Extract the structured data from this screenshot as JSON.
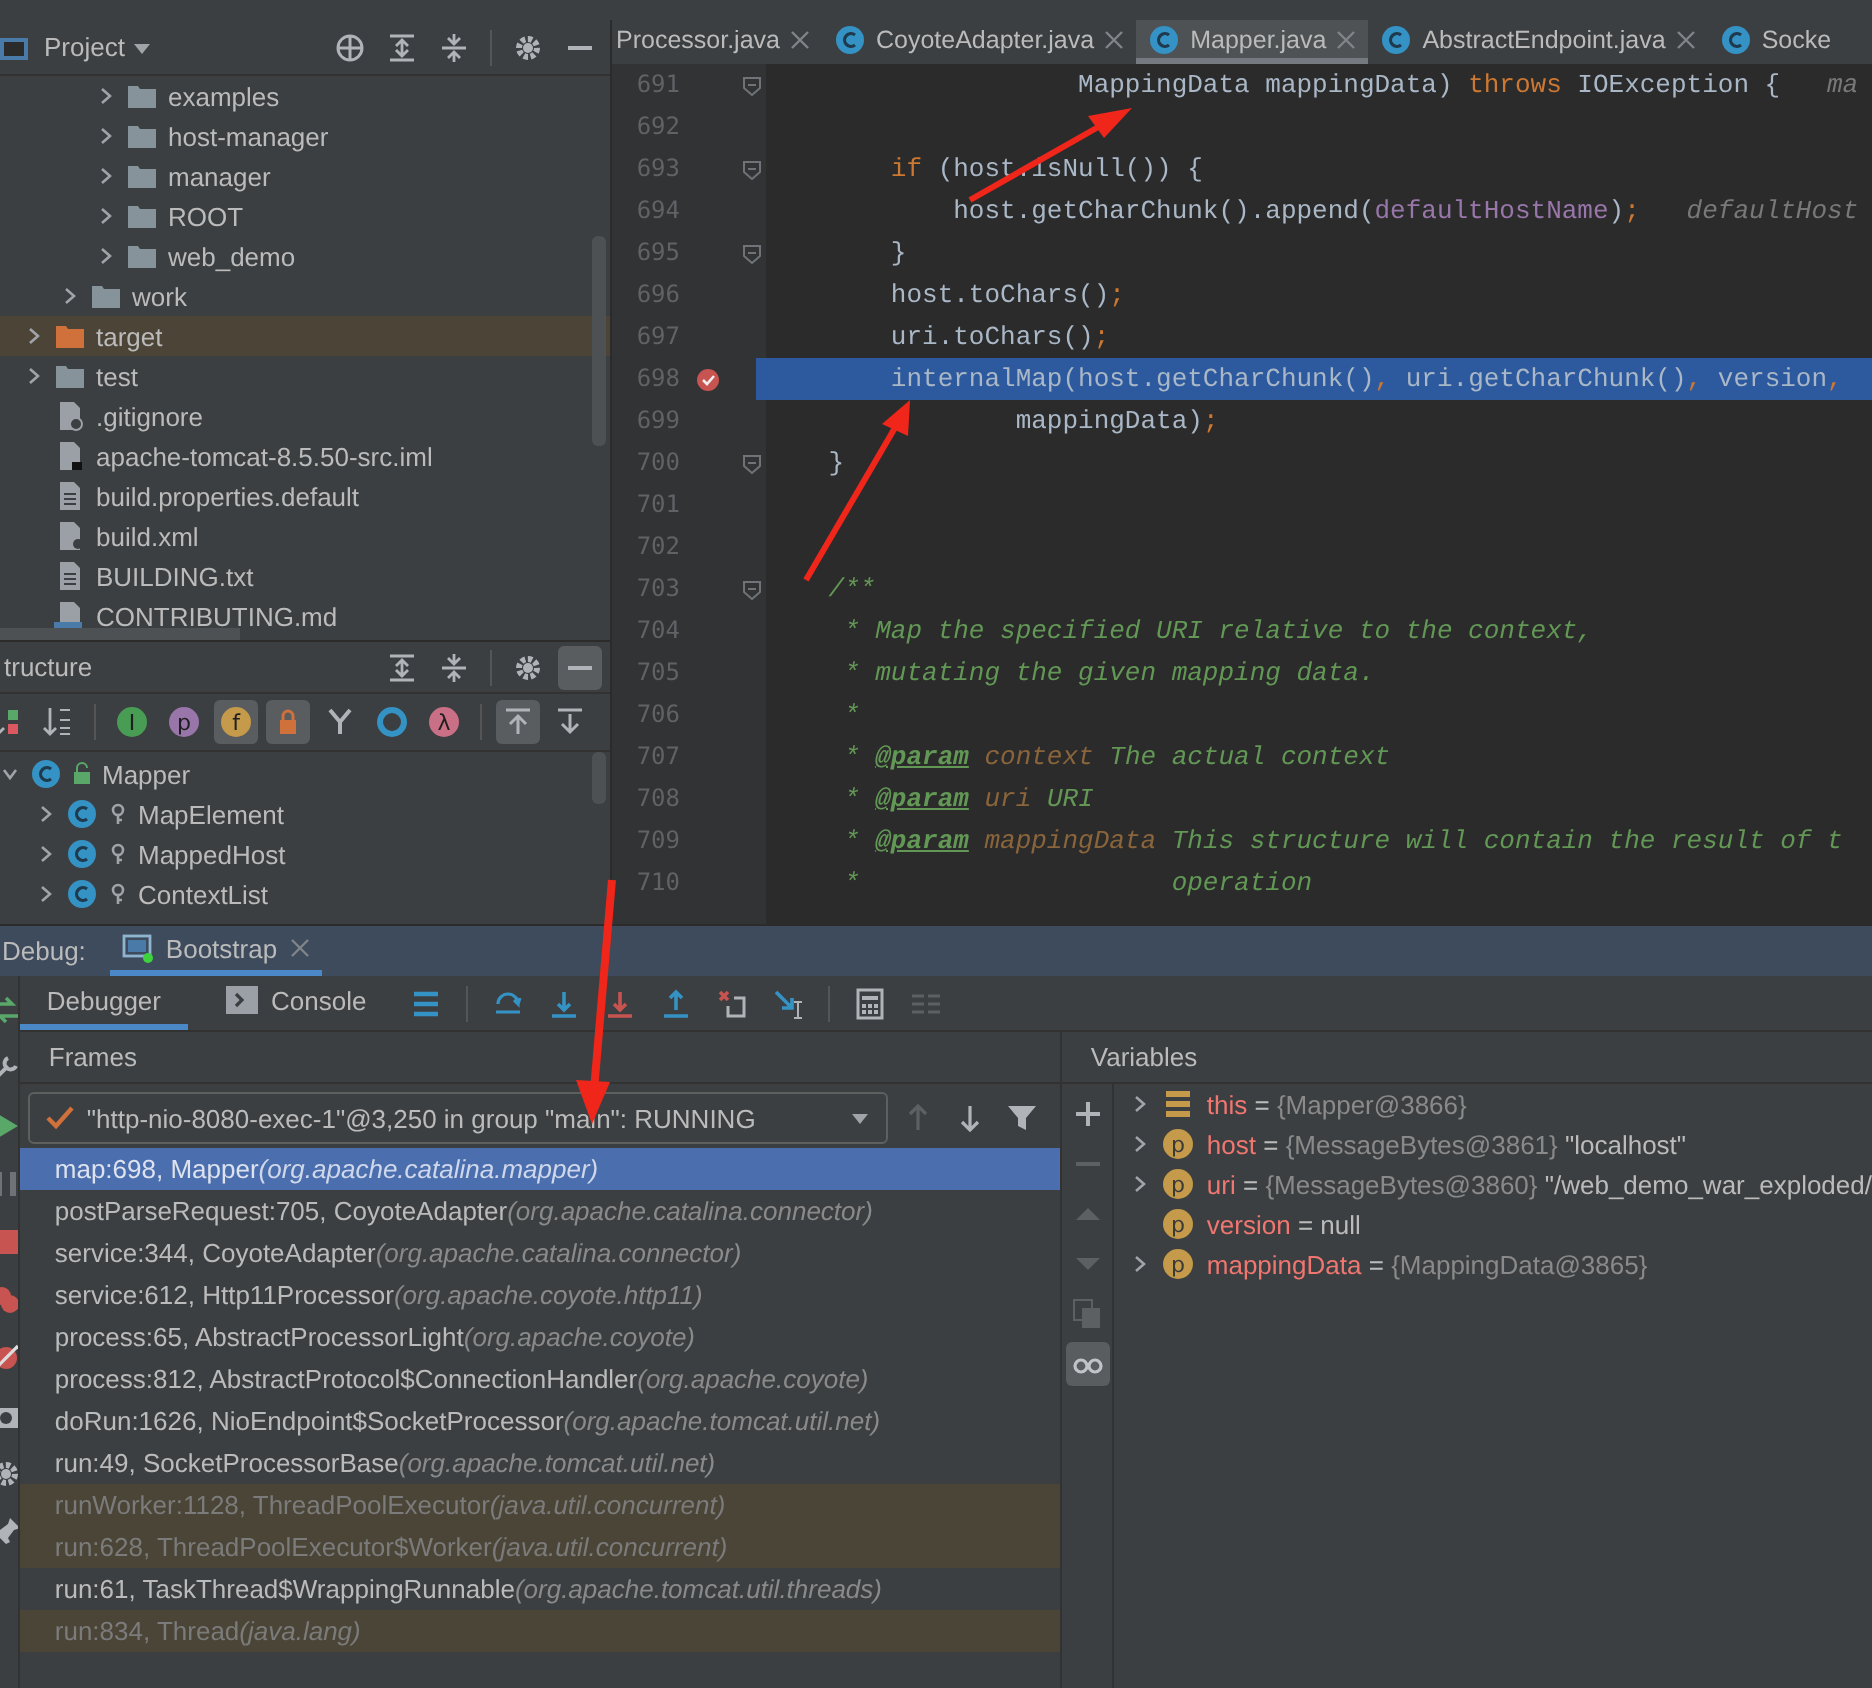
{
  "project": {
    "title": "Project",
    "tree": [
      {
        "children": [
          {
            "children": [
              {
                "label": "examples",
                "kind": "folder",
                "selected": false
              },
              {
                "label": "host-manager",
                "kind": "folder",
                "selected": false
              },
              {
                "label": "manager",
                "kind": "folder",
                "selected": false
              },
              {
                "label": "ROOT",
                "kind": "folder",
                "selected": false
              },
              {
                "label": "web_demo",
                "kind": "folder",
                "selected": false
              }
            ]
          },
          {
            "label": "work",
            "kind": "folder",
            "selected": false
          }
        ]
      },
      {
        "label": "target",
        "kind": "excluded-folder",
        "selected": true
      },
      {
        "label": "test",
        "kind": "folder",
        "selected": false
      },
      {
        "label": ".gitignore",
        "kind": "ignore-file",
        "selected": false
      },
      {
        "label": "apache-tomcat-8.5.50-src.iml",
        "kind": "module-file",
        "selected": false
      },
      {
        "label": "build.properties.default",
        "kind": "text-file",
        "selected": false
      },
      {
        "label": "build.xml",
        "kind": "ant-file",
        "selected": false
      },
      {
        "label": "BUILDING.txt",
        "kind": "text-file",
        "selected": false
      },
      {
        "label": "CONTRIBUTING.md",
        "kind": "markdown-file",
        "selected": false
      }
    ]
  },
  "structure": {
    "title": "tructure",
    "tools": [
      {
        "kind": "visibility-sort",
        "on": false
      },
      {
        "kind": "alpha-sort",
        "on": false
      },
      {
        "kind": "badge",
        "glyph": "I",
        "color": "#499c54",
        "on": false
      },
      {
        "kind": "badge",
        "glyph": "p",
        "color": "#9876aa",
        "on": false
      },
      {
        "kind": "badge",
        "glyph": "f",
        "color": "#c59a4a",
        "on": true
      },
      {
        "kind": "lock",
        "on": true
      },
      {
        "kind": "fork",
        "on": false
      },
      {
        "kind": "ring",
        "on": false
      },
      {
        "kind": "badge",
        "glyph": "λ",
        "color": "#c96f86",
        "on": false
      },
      {
        "kind": "autoscroll-to",
        "on": true
      },
      {
        "kind": "autoscroll-from",
        "on": false
      }
    ],
    "items": [
      {
        "label": "Mapper",
        "expanded": true,
        "children": [
          {
            "label": "MapElement",
            "expanded": false
          },
          {
            "label": "MappedHost",
            "expanded": false
          },
          {
            "label": "ContextList",
            "expanded": false
          }
        ]
      }
    ]
  },
  "editor": {
    "tabs": [
      {
        "label": "Processor.java",
        "selected": false
      },
      {
        "label": "CoyoteAdapter.java",
        "selected": false
      },
      {
        "label": "Mapper.java",
        "selected": true
      },
      {
        "label": "AbstractEndpoint.java",
        "selected": false
      },
      {
        "label": "Socke",
        "selected": false
      }
    ],
    "lines": [
      {
        "number": "691",
        "fold": true,
        "breakpoint": false,
        "current": false,
        "tokens": [
          {
            "kind": "plain",
            "text": "                    MappingData mappingData) "
          },
          {
            "kind": "keyword",
            "text": "throws"
          },
          {
            "kind": "plain",
            "text": " IOException {   "
          },
          {
            "kind": "hint",
            "text": "ma"
          }
        ]
      },
      {
        "number": "692",
        "fold": false,
        "breakpoint": false,
        "current": false
      },
      {
        "number": "693",
        "fold": true,
        "breakpoint": false,
        "current": false,
        "tokens": [
          {
            "kind": "keyword",
            "text": "        if"
          },
          {
            "kind": "plain",
            "text": " (host.isNull()) {"
          }
        ]
      },
      {
        "number": "694",
        "fold": false,
        "breakpoint": false,
        "current": false,
        "tokens": [
          {
            "kind": "plain",
            "text": "            host.getCharChunk().append("
          },
          {
            "kind": "field",
            "text": "defaultHostName"
          },
          {
            "kind": "plain",
            "text": ")"
          },
          {
            "kind": "keyword",
            "text": ";"
          },
          {
            "kind": "hint",
            "text": "   defaultHost"
          }
        ]
      },
      {
        "number": "695",
        "fold": true,
        "breakpoint": false,
        "current": false,
        "tokens": [
          {
            "kind": "plain",
            "text": "        }"
          }
        ]
      },
      {
        "number": "696",
        "fold": false,
        "breakpoint": false,
        "current": false,
        "tokens": [
          {
            "kind": "plain",
            "text": "        host.toChars()"
          },
          {
            "kind": "keyword",
            "text": ";"
          }
        ]
      },
      {
        "number": "697",
        "fold": false,
        "breakpoint": false,
        "current": false,
        "tokens": [
          {
            "kind": "plain",
            "text": "        uri.toChars()"
          },
          {
            "kind": "keyword",
            "text": ";"
          }
        ]
      },
      {
        "number": "698",
        "fold": false,
        "breakpoint": true,
        "current": true,
        "tokens": [
          {
            "kind": "plain",
            "text": "        internalMap(host.getCharChunk()"
          },
          {
            "kind": "keyword",
            "text": ","
          },
          {
            "kind": "plain",
            "text": " uri.getCharChunk()"
          },
          {
            "kind": "keyword",
            "text": ","
          },
          {
            "kind": "plain",
            "text": " version"
          },
          {
            "kind": "keyword",
            "text": ","
          }
        ]
      },
      {
        "number": "699",
        "fold": false,
        "breakpoint": false,
        "current": false,
        "tokens": [
          {
            "kind": "plain",
            "text": "                mappingData)"
          },
          {
            "kind": "keyword",
            "text": ";"
          }
        ]
      },
      {
        "number": "700",
        "fold": true,
        "breakpoint": false,
        "current": false,
        "tokens": [
          {
            "kind": "plain",
            "text": "    }"
          }
        ]
      },
      {
        "number": "701",
        "fold": false,
        "breakpoint": false,
        "current": false
      },
      {
        "number": "702",
        "fold": false,
        "breakpoint": false,
        "current": false
      },
      {
        "number": "703",
        "fold": true,
        "breakpoint": false,
        "current": false,
        "tokens": [
          {
            "kind": "comment",
            "text": "    /**"
          }
        ]
      },
      {
        "number": "704",
        "fold": false,
        "breakpoint": false,
        "current": false,
        "tokens": [
          {
            "kind": "comment",
            "text": "     * Map the specified URI relative to the context,"
          }
        ]
      },
      {
        "number": "705",
        "fold": false,
        "breakpoint": false,
        "current": false,
        "tokens": [
          {
            "kind": "comment",
            "text": "     * mutating the given mapping data."
          }
        ]
      },
      {
        "number": "706",
        "fold": false,
        "breakpoint": false,
        "current": false,
        "tokens": [
          {
            "kind": "comment",
            "text": "     *"
          }
        ]
      },
      {
        "number": "707",
        "fold": false,
        "breakpoint": false,
        "current": false,
        "tokens": [
          {
            "kind": "comment",
            "text": "     * "
          },
          {
            "kind": "doc-tag",
            "text": "@param"
          },
          {
            "kind": "doc-param",
            "text": " context"
          },
          {
            "kind": "comment",
            "text": " The actual context"
          }
        ]
      },
      {
        "number": "708",
        "fold": false,
        "breakpoint": false,
        "current": false,
        "tokens": [
          {
            "kind": "comment",
            "text": "     * "
          },
          {
            "kind": "doc-tag",
            "text": "@param"
          },
          {
            "kind": "doc-param",
            "text": " uri"
          },
          {
            "kind": "comment",
            "text": " URI"
          }
        ]
      },
      {
        "number": "709",
        "fold": false,
        "breakpoint": false,
        "current": false,
        "tokens": [
          {
            "kind": "comment",
            "text": "     * "
          },
          {
            "kind": "doc-tag",
            "text": "@param"
          },
          {
            "kind": "doc-param",
            "text": " mappingData"
          },
          {
            "kind": "comment",
            "text": " This structure will contain the result of t"
          }
        ]
      },
      {
        "number": "710",
        "fold": false,
        "breakpoint": false,
        "current": false,
        "tokens": [
          {
            "kind": "comment",
            "text": "     *                    operation"
          }
        ]
      }
    ]
  },
  "debug": {
    "label": "Debug:",
    "session": "Bootstrap",
    "tabs": [
      {
        "label": "Debugger",
        "selected": true
      },
      {
        "label": "Console",
        "selected": false
      }
    ],
    "frames": {
      "title": "Frames",
      "thread": "\"http-nio-8080-exec-1\"@3,250 in group \"main\": RUNNING",
      "rows": [
        {
          "method": "map:698, Mapper",
          "package": "(org.apache.catalina.mapper)",
          "selected": true,
          "library": false
        },
        {
          "method": "postParseRequest:705, CoyoteAdapter",
          "package": "(org.apache.catalina.connector)",
          "selected": false,
          "library": false
        },
        {
          "method": "service:344, CoyoteAdapter",
          "package": "(org.apache.catalina.connector)",
          "selected": false,
          "library": false
        },
        {
          "method": "service:612, Http11Processor",
          "package": "(org.apache.coyote.http11)",
          "selected": false,
          "library": false
        },
        {
          "method": "process:65, AbstractProcessorLight",
          "package": "(org.apache.coyote)",
          "selected": false,
          "library": false
        },
        {
          "method": "process:812, AbstractProtocol$ConnectionHandler",
          "package": "(org.apache.coyote)",
          "selected": false,
          "library": false
        },
        {
          "method": "doRun:1626, NioEndpoint$SocketProcessor",
          "package": "(org.apache.tomcat.util.net)",
          "selected": false,
          "library": false
        },
        {
          "method": "run:49, SocketProcessorBase",
          "package": "(org.apache.tomcat.util.net)",
          "selected": false,
          "library": false
        },
        {
          "method": "runWorker:1128, ThreadPoolExecutor",
          "package": "(java.util.concurrent)",
          "selected": false,
          "library": true
        },
        {
          "method": "run:628, ThreadPoolExecutor$Worker",
          "package": "(java.util.concurrent)",
          "selected": false,
          "library": true
        },
        {
          "method": "run:61, TaskThread$WrappingRunnable",
          "package": "(org.apache.tomcat.util.threads)",
          "selected": false,
          "library": false
        },
        {
          "method": "run:834, Thread",
          "package": "(java.lang)",
          "selected": false,
          "library": true
        }
      ]
    },
    "variables": {
      "title": "Variables",
      "rows": [
        {
          "kind": "object",
          "expandable": true,
          "name": "this",
          "op": "=",
          "ref": "{Mapper@3866}"
        },
        {
          "kind": "field",
          "glyph": "p",
          "expandable": true,
          "name": "host",
          "op": "=",
          "ref": "{MessageBytes@3861}",
          "value": "\"localhost\""
        },
        {
          "kind": "field",
          "glyph": "p",
          "expandable": true,
          "name": "uri",
          "op": "=",
          "ref": "{MessageBytes@3860}",
          "value": "\"/web_demo_war_exploded/"
        },
        {
          "kind": "field",
          "glyph": "p",
          "expandable": false,
          "name": "version",
          "op": "=",
          "value": "null"
        },
        {
          "kind": "field",
          "glyph": "p",
          "expandable": true,
          "name": "mappingData",
          "op": "=",
          "ref": "{MappingData@3865}"
        }
      ]
    }
  }
}
